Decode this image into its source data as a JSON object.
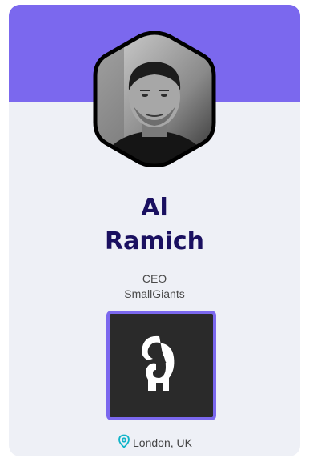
{
  "colors": {
    "accent": "#7b68ee",
    "name": "#1a1060",
    "pin": "#11b4c9",
    "card_bg": "#eef0f6",
    "logo_bg": "#2a2a2a"
  },
  "profile": {
    "first_name": "Al",
    "last_name": "Ramich",
    "role": "CEO",
    "company": "SmallGiants",
    "location": "London, UK"
  },
  "icons": {
    "location": "map-pin-icon",
    "company_logo": "elephant-logo-icon"
  }
}
